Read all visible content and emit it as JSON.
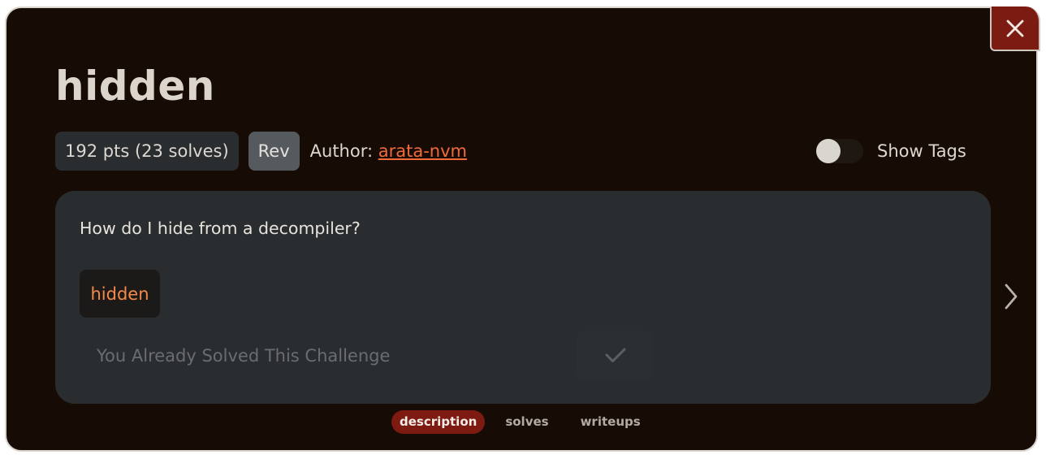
{
  "challenge": {
    "title": "hidden",
    "points": "192 pts (23 solves)",
    "category": "Rev",
    "author_label": "Author: ",
    "author_name": "arata-nvm",
    "description": "How do I hide from a decompiler?",
    "file_name": "hidden",
    "solved_placeholder": "You Already Solved This Challenge"
  },
  "tags_toggle": {
    "label": "Show Tags",
    "enabled": false
  },
  "tabs": [
    {
      "label": "description",
      "active": true
    },
    {
      "label": "solves",
      "active": false
    },
    {
      "label": "writeups",
      "active": false
    }
  ],
  "icons": {
    "close": "close-icon",
    "submit": "check-icon",
    "next": "chevron-right-icon"
  },
  "colors": {
    "modal_background": "#170c05",
    "panel_background": "#2a2d30",
    "accent": "#7d1a11",
    "link": "#f06a3a",
    "file_link": "#f48a46"
  }
}
